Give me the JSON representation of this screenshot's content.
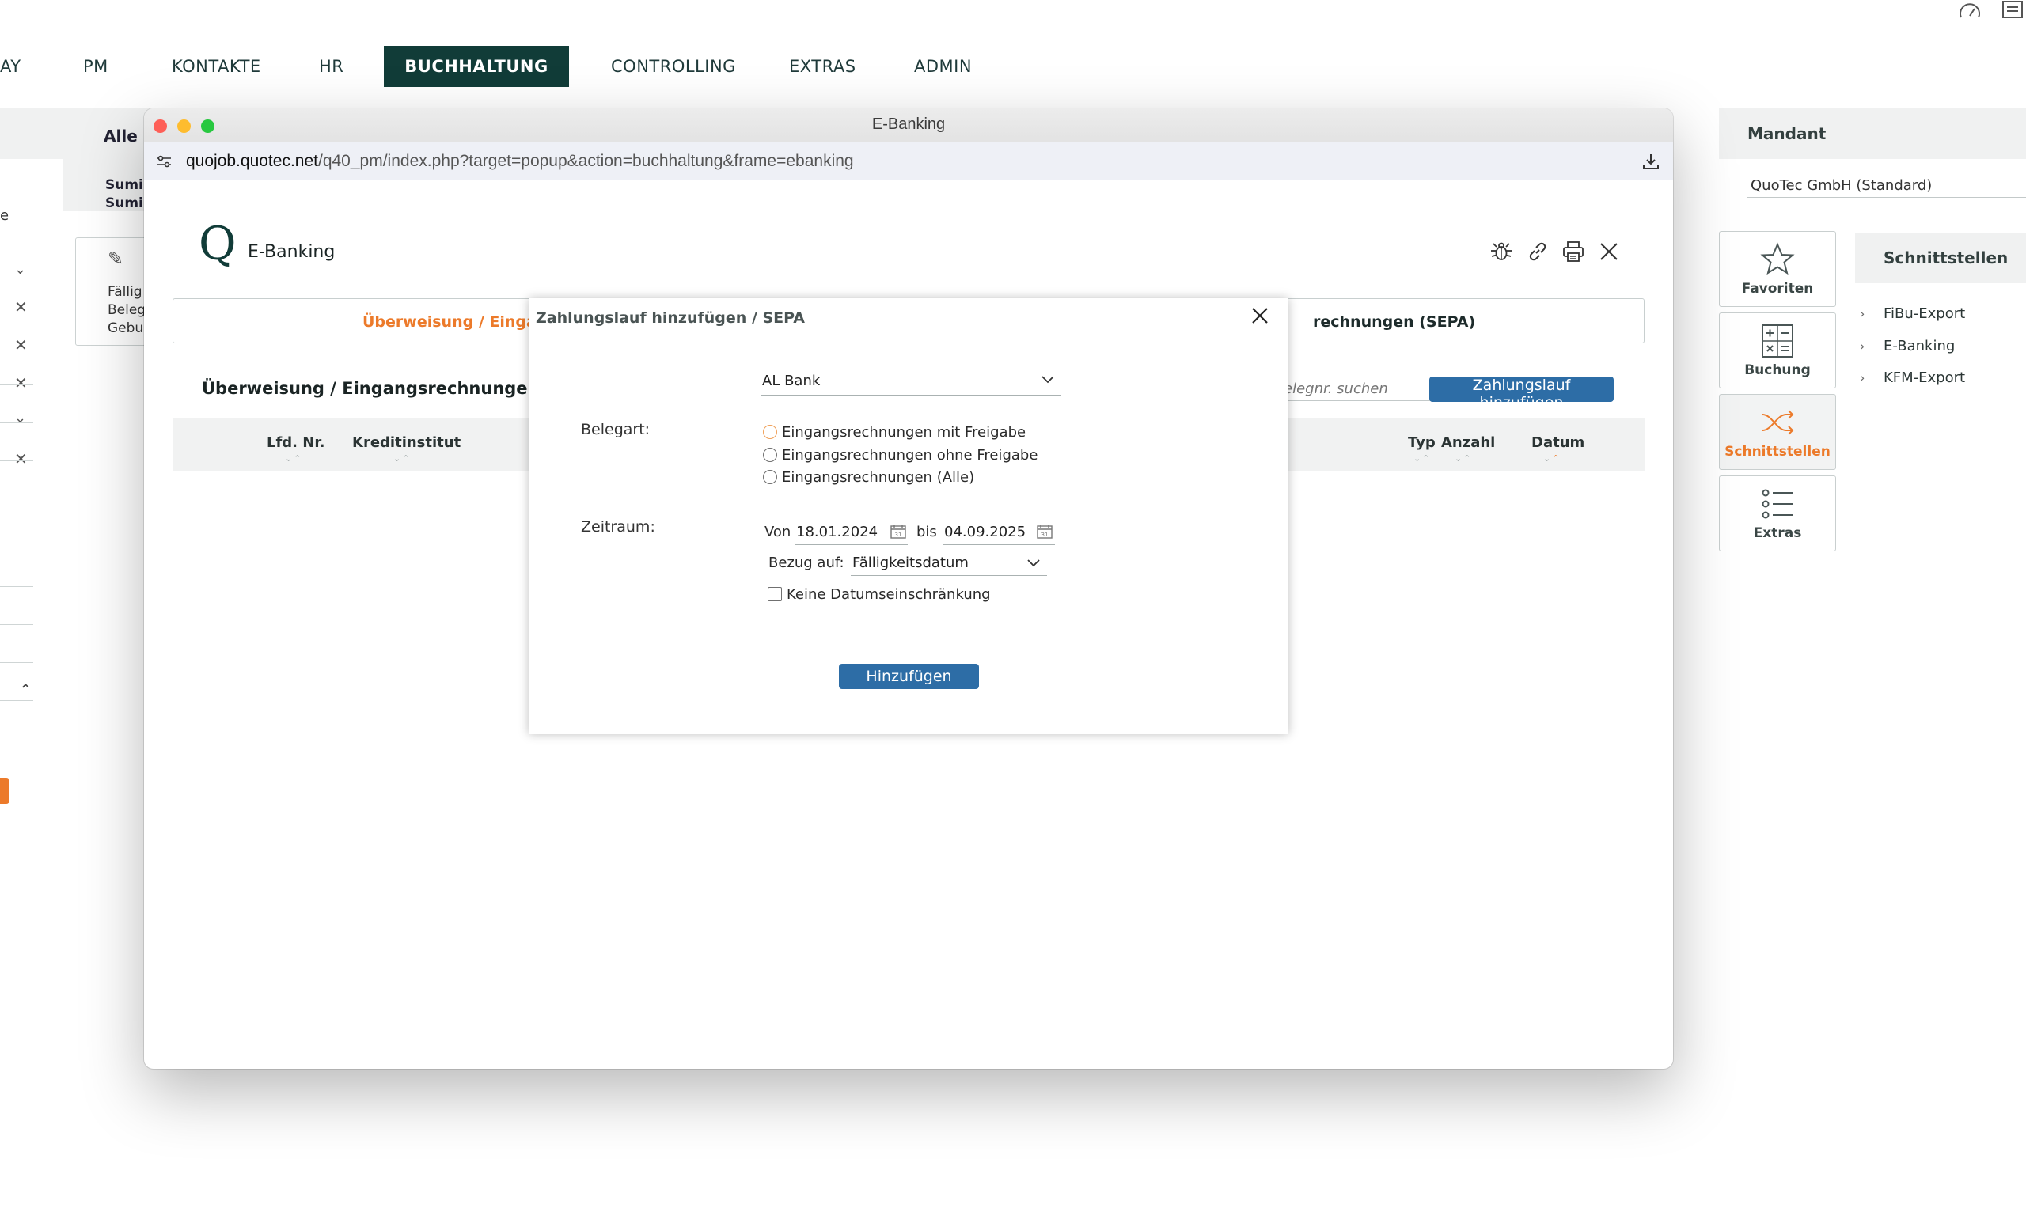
{
  "top_nav": [
    {
      "label": "AY"
    },
    {
      "label": "PM"
    },
    {
      "label": "KONTAKTE"
    },
    {
      "label": "HR"
    },
    {
      "label": "BUCHHALTUNG",
      "active": true
    },
    {
      "label": "CONTROLLING"
    },
    {
      "label": "EXTRAS"
    },
    {
      "label": "ADMIN"
    }
  ],
  "background": {
    "alle": "Alle",
    "sum1": "Sumi",
    "sum2": "Sumi",
    "faellig": "Fällig",
    "beleg": "Beleg",
    "gebu": "Gebu",
    "left_char": "e"
  },
  "right_panel": {
    "mandant_title": "Mandant",
    "mandant_value": "QuoTec GmbH (Standard)",
    "tiles": [
      {
        "label": "Favoriten",
        "icon": "star-icon"
      },
      {
        "label": "Buchung",
        "icon": "calculator-icon"
      },
      {
        "label": "Schnittstellen",
        "icon": "shuffle-icon",
        "active": true
      },
      {
        "label": "Extras",
        "icon": "list-icon"
      }
    ],
    "schnittstellen_title": "Schnittstellen",
    "schnittstellen_items": [
      "FiBu-Export",
      "E-Banking",
      "KFM-Export"
    ]
  },
  "window": {
    "title": "E-Banking",
    "url_host": "quojob.quotec.net",
    "url_path": "/q40_pm/index.php?target=popup&action=buchhaltung&frame=ebanking",
    "app_logo": "Q",
    "app_title": "E-Banking",
    "tab_active": "Überweisung / Einga",
    "tab_other": "rechnungen (SEPA)",
    "section_title": "Überweisung / Eingangsrechnungen",
    "search_placeholder": "elegnr. suchen",
    "add_run_button": "Zahlungslauf hinzufügen",
    "table_headers_left": [
      "Lfd. Nr.",
      "Kreditinstitut"
    ],
    "table_headers_right": [
      "Typ",
      "Anzahl",
      "Datum"
    ]
  },
  "modal": {
    "title": "Zahlungslauf hinzufügen / SEPA",
    "bank_select": "AL Bank",
    "belegart_label": "Belegart:",
    "belegart_options": [
      "Eingangsrechnungen mit Freigabe",
      "Eingangsrechnungen ohne Freigabe",
      "Eingangsrechnungen (Alle)"
    ],
    "zeitraum_label": "Zeitraum:",
    "von_label": "Von",
    "von_value": "18.01.2024",
    "bis_label": "bis",
    "bis_value": "04.09.2025",
    "bezug_label": "Bezug auf:",
    "bezug_value": "Fälligkeitsdatum",
    "no_date_limit_label": "Keine Datumseinschränkung",
    "submit_label": "Hinzufügen"
  },
  "colors": {
    "brand_dark": "#113c38",
    "accent_orange": "#ec7a2a",
    "button_blue": "#2d6da6"
  }
}
